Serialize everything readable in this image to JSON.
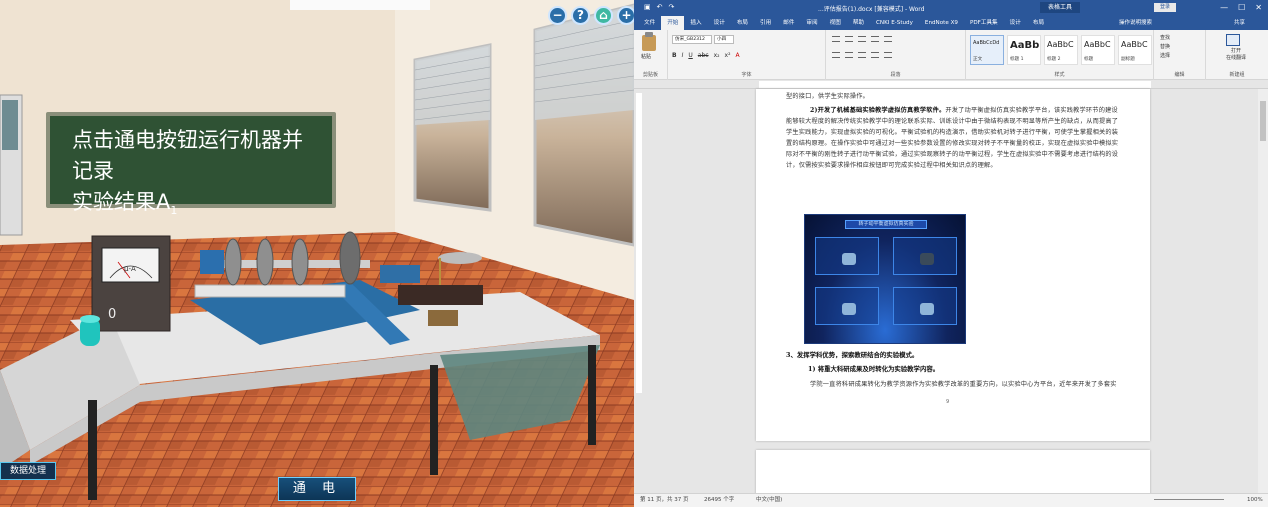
{
  "simulation": {
    "blackboard_line1": "点击通电按钮运行机器并记录",
    "blackboard_line2": "实验结果A",
    "blackboard_subscript": "1",
    "meter_reading": "0",
    "meter_label": "μ-A",
    "top_buttons": [
      "−",
      "?",
      "⌂",
      "+"
    ],
    "data_button": "数据处理",
    "power_button": "通 电"
  },
  "word": {
    "doc_title": "...评估报告(1).docx [兼容模式] - Word",
    "context_tab": "表格工具",
    "sign_in": "登录",
    "tabs": [
      "文件",
      "开始",
      "插入",
      "设计",
      "布局",
      "引用",
      "邮件",
      "审阅",
      "视图",
      "帮助",
      "CNKI E-Study",
      "EndNote X9",
      "PDF工具集",
      "设计",
      "布局"
    ],
    "active_tab": 1,
    "tell_me": "操作说明搜索",
    "share": "共享",
    "ribbon": {
      "paste": "粘贴",
      "clipboard": "剪贴板",
      "font_name": "仿宋_GB2312",
      "font_size": "小四",
      "font_group": "字体",
      "paragraph_group": "段落",
      "styles_group": "样式",
      "editing_group": "编辑",
      "voice_group": "新建组",
      "find": "查找",
      "replace": "替换",
      "select": "选择",
      "open_app": "打开",
      "open_app_sub": "在线翻译",
      "styles": [
        {
          "sample": "AaBbCcDd",
          "name": "正文"
        },
        {
          "sample": "AaBb",
          "name": "标题 1"
        },
        {
          "sample": "AaBbC",
          "name": "标题 2"
        },
        {
          "sample": "AaBbC",
          "name": "标题"
        },
        {
          "sample": "AaBbC",
          "name": "副标题"
        }
      ]
    },
    "page": {
      "line0": "型的接口，供学生实际操作。",
      "para1_bold": "2)开发了机械基础实验教学虚拟仿真教学软件。",
      "para1": "开发了动平衡虚拟仿真实验教学平台，该实践教学环节的建设能够较大程度的解决传统实验教学中的理论联系实际、训练设计中由于微结构表现不明显等所产生的缺点，从而提高了学生实践能力，实现虚拟实验的可视化。平衡试验机的构造演示，借助实验机对转子进行平衡，可使学生掌握相关的装置的结构原理。在操作实验中可通过对一些实验参数设置的修改实现对转子不平衡量的校正，实现在虚拟实验中模拟实际对不平衡的刚性转子进行动平衡试验，通过实验观察转子的动平衡过程，学生在虚拟实验中不需要考虑进行结构的设计，仅需按实验要求操作相应按钮即可完成实验过程中相关知识点的理解。",
      "figure_title": "转子动平衡虚拟仿真实验",
      "heading3": "3、发挥学科优势，探索教研结合的实验模式。",
      "sub1": "1) 将重大科研成果及时转化为实验教学内容。",
      "para2": "学院一直将科研成果转化为教学资源作为实验教学改革的重要方向，以实验中心为平台，近年来开发了多套实验装置，推进了一批研究型实验项目。",
      "page_no": "9"
    },
    "status": {
      "page": "第 11 页，共 37 页",
      "words": "26495 个字",
      "lang": "中文(中国)",
      "zoom": "100%"
    }
  }
}
